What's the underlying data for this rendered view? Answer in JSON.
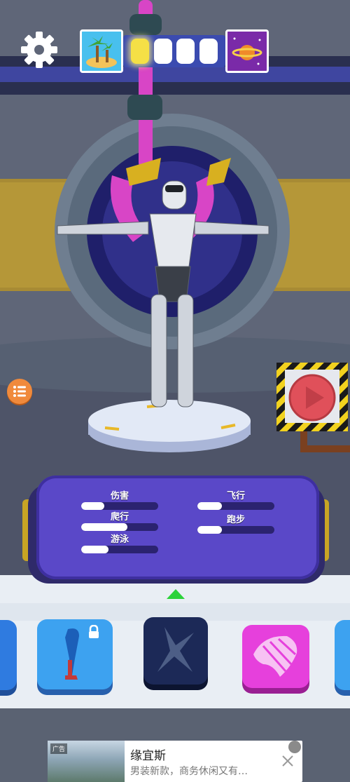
{
  "hud": {
    "settings_icon": "gear-icon",
    "progress": {
      "start_icon": "island-icon",
      "end_icon": "planet-icon",
      "slots_total": 4,
      "slots_filled": 1
    }
  },
  "stats": {
    "damage": {
      "label": "伤害",
      "fill": 0.3
    },
    "climb": {
      "label": "爬行",
      "fill": 0.6
    },
    "swim": {
      "label": "游泳",
      "fill": 0.35
    },
    "fly": {
      "label": "飞行",
      "fill": 0.32
    },
    "run": {
      "label": "跑步",
      "fill": 0.32
    }
  },
  "parts": [
    {
      "name": "leg-part",
      "locked": true
    },
    {
      "name": "sword-part",
      "locked": false,
      "selected": true
    },
    {
      "name": "wing-part",
      "locked": false
    }
  ],
  "ad": {
    "tag": "广告",
    "title": "缘宜斯",
    "description": "男装新款，商务休闲又有…"
  },
  "colors": {
    "panel": "#5a48c8",
    "accent_yellow": "#f5e046",
    "play_red": "#e0505a",
    "card_pink": "#e640dc"
  }
}
